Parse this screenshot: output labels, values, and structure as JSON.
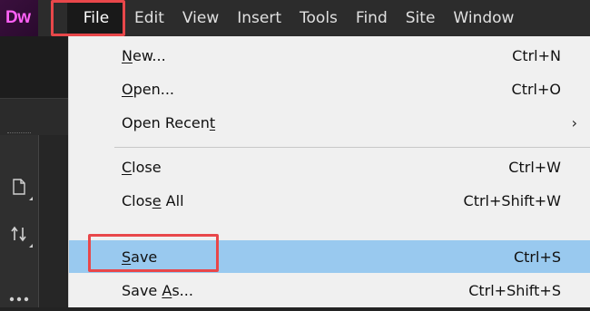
{
  "app": {
    "logo_text": "Dw",
    "logo_color": "#ff61f6"
  },
  "menubar": {
    "items": [
      {
        "id": "file",
        "label": "File",
        "active": true
      },
      {
        "id": "edit",
        "label": "Edit"
      },
      {
        "id": "view",
        "label": "View"
      },
      {
        "id": "insert",
        "label": "Insert"
      },
      {
        "id": "tools",
        "label": "Tools"
      },
      {
        "id": "find",
        "label": "Find"
      },
      {
        "id": "site",
        "label": "Site"
      },
      {
        "id": "window",
        "label": "Window"
      }
    ]
  },
  "file_menu": {
    "items": [
      {
        "id": "new",
        "mnemonic": "N",
        "rest": "ew...",
        "shortcut": "Ctrl+N"
      },
      {
        "id": "open",
        "mnemonic": "O",
        "rest": "pen...",
        "shortcut": "Ctrl+O"
      },
      {
        "id": "open-recent",
        "pre": "Open Recen",
        "mnemonic": "t",
        "submenu_arrow": "›"
      },
      {
        "id": "close",
        "mnemonic": "C",
        "rest": "lose",
        "shortcut": "Ctrl+W"
      },
      {
        "id": "close-all",
        "pre": "Clos",
        "mnemonic": "e",
        "rest": " All",
        "shortcut": "Ctrl+Shift+W"
      },
      {
        "id": "save",
        "mnemonic": "S",
        "rest": "ave",
        "shortcut": "Ctrl+S",
        "highlighted": true
      },
      {
        "id": "save-as",
        "pre": "Save ",
        "mnemonic": "A",
        "rest": "s...",
        "shortcut": "Ctrl+Shift+S"
      }
    ]
  },
  "colors": {
    "highlight": "#99c9ef",
    "callout": "#e8474a",
    "menubar_bg": "#2c2c2c",
    "dropdown_bg": "#f0f0f0"
  },
  "left_tools": {
    "icons": [
      "file-icon",
      "sort-arrows-icon",
      "more-icon"
    ]
  }
}
